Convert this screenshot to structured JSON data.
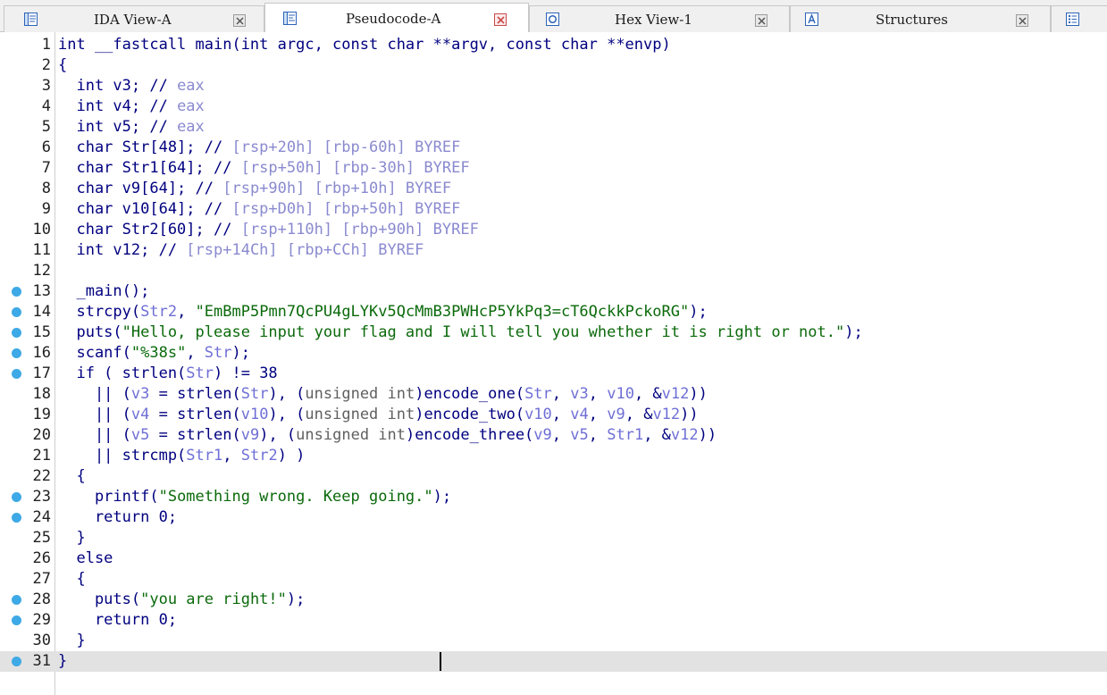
{
  "tabs": [
    {
      "label": "IDA View-A",
      "icon": "disassembly-view-icon",
      "active": false
    },
    {
      "label": "Pseudocode-A",
      "icon": "pseudocode-icon",
      "active": true
    },
    {
      "label": "Hex View-1",
      "icon": "hex-view-icon",
      "active": false
    },
    {
      "label": "Structures",
      "icon": "structures-icon",
      "active": false
    },
    {
      "icon": "enums-icon",
      "active": false
    }
  ],
  "colors": {
    "keyword": "#000080",
    "variable": "#6f6fd6",
    "comment": "#8a8ad0",
    "string": "#0b6a0b",
    "breakpoint": "#3da9e6",
    "current_line": "#e2e2e2"
  },
  "code_lines": [
    {
      "num": "1",
      "bp": false,
      "tokens": [
        [
          "n",
          "int __fastcall main(int argc, const char **argv, const char **envp)"
        ]
      ]
    },
    {
      "num": "2",
      "bp": false,
      "tokens": [
        [
          "n",
          "{"
        ]
      ]
    },
    {
      "num": "3",
      "bp": false,
      "tokens": [
        [
          "n",
          "  int v3; // "
        ],
        [
          "c",
          "eax"
        ]
      ]
    },
    {
      "num": "4",
      "bp": false,
      "tokens": [
        [
          "n",
          "  int v4; // "
        ],
        [
          "c",
          "eax"
        ]
      ]
    },
    {
      "num": "5",
      "bp": false,
      "tokens": [
        [
          "n",
          "  int v5; // "
        ],
        [
          "c",
          "eax"
        ]
      ]
    },
    {
      "num": "6",
      "bp": false,
      "tokens": [
        [
          "n",
          "  char Str[48]; // "
        ],
        [
          "c",
          "[rsp+20h] [rbp-60h] BYREF"
        ]
      ]
    },
    {
      "num": "7",
      "bp": false,
      "tokens": [
        [
          "n",
          "  char Str1[64]; // "
        ],
        [
          "c",
          "[rsp+50h] [rbp-30h] BYREF"
        ]
      ]
    },
    {
      "num": "8",
      "bp": false,
      "tokens": [
        [
          "n",
          "  char v9[64]; // "
        ],
        [
          "c",
          "[rsp+90h] [rbp+10h] BYREF"
        ]
      ]
    },
    {
      "num": "9",
      "bp": false,
      "tokens": [
        [
          "n",
          "  char v10[64]; // "
        ],
        [
          "c",
          "[rsp+D0h] [rbp+50h] BYREF"
        ]
      ]
    },
    {
      "num": "10",
      "bp": false,
      "tokens": [
        [
          "n",
          "  char Str2[60]; // "
        ],
        [
          "c",
          "[rsp+110h] [rbp+90h] BYREF"
        ]
      ]
    },
    {
      "num": "11",
      "bp": false,
      "tokens": [
        [
          "n",
          "  int v12; // "
        ],
        [
          "c",
          "[rsp+14Ch] [rbp+CCh] BYREF"
        ]
      ]
    },
    {
      "num": "12",
      "bp": false,
      "tokens": []
    },
    {
      "num": "13",
      "bp": true,
      "tokens": [
        [
          "n",
          "  _main();"
        ]
      ]
    },
    {
      "num": "14",
      "bp": true,
      "tokens": [
        [
          "n",
          "  strcpy("
        ],
        [
          "v",
          "Str2"
        ],
        [
          "n",
          ", "
        ],
        [
          "s",
          "\"EmBmP5Pmn7QcPU4gLYKv5QcMmB3PWHcP5YkPq3=cT6QckkPckoRG\""
        ],
        [
          "n",
          ");"
        ]
      ]
    },
    {
      "num": "15",
      "bp": true,
      "tokens": [
        [
          "n",
          "  puts("
        ],
        [
          "s",
          "\"Hello, please input your flag and I will tell you whether it is right or not.\""
        ],
        [
          "n",
          ");"
        ]
      ]
    },
    {
      "num": "16",
      "bp": true,
      "tokens": [
        [
          "n",
          "  scanf("
        ],
        [
          "s",
          "\"%38s\""
        ],
        [
          "n",
          ", "
        ],
        [
          "v",
          "Str"
        ],
        [
          "n",
          ");"
        ]
      ]
    },
    {
      "num": "17",
      "bp": true,
      "tokens": [
        [
          "n",
          "  if ( strlen("
        ],
        [
          "v",
          "Str"
        ],
        [
          "n",
          ") != 38"
        ]
      ]
    },
    {
      "num": "18",
      "bp": false,
      "tokens": [
        [
          "n",
          "    || ("
        ],
        [
          "v",
          "v3"
        ],
        [
          "n",
          " = strlen("
        ],
        [
          "v",
          "Str"
        ],
        [
          "n",
          "), ("
        ],
        [
          "u",
          "unsigned int"
        ],
        [
          "n",
          ")encode_one("
        ],
        [
          "v",
          "Str"
        ],
        [
          "n",
          ", "
        ],
        [
          "v",
          "v3"
        ],
        [
          "n",
          ", "
        ],
        [
          "v",
          "v10"
        ],
        [
          "n",
          ", &"
        ],
        [
          "v",
          "v12"
        ],
        [
          "n",
          "))"
        ]
      ]
    },
    {
      "num": "19",
      "bp": false,
      "tokens": [
        [
          "n",
          "    || ("
        ],
        [
          "v",
          "v4"
        ],
        [
          "n",
          " = strlen("
        ],
        [
          "v",
          "v10"
        ],
        [
          "n",
          "), ("
        ],
        [
          "u",
          "unsigned int"
        ],
        [
          "n",
          ")encode_two("
        ],
        [
          "v",
          "v10"
        ],
        [
          "n",
          ", "
        ],
        [
          "v",
          "v4"
        ],
        [
          "n",
          ", "
        ],
        [
          "v",
          "v9"
        ],
        [
          "n",
          ", &"
        ],
        [
          "v",
          "v12"
        ],
        [
          "n",
          "))"
        ]
      ]
    },
    {
      "num": "20",
      "bp": false,
      "tokens": [
        [
          "n",
          "    || ("
        ],
        [
          "v",
          "v5"
        ],
        [
          "n",
          " = strlen("
        ],
        [
          "v",
          "v9"
        ],
        [
          "n",
          "), ("
        ],
        [
          "u",
          "unsigned int"
        ],
        [
          "n",
          ")encode_three("
        ],
        [
          "v",
          "v9"
        ],
        [
          "n",
          ", "
        ],
        [
          "v",
          "v5"
        ],
        [
          "n",
          ", "
        ],
        [
          "v",
          "Str1"
        ],
        [
          "n",
          ", &"
        ],
        [
          "v",
          "v12"
        ],
        [
          "n",
          "))"
        ]
      ]
    },
    {
      "num": "21",
      "bp": false,
      "tokens": [
        [
          "n",
          "    || strcmp("
        ],
        [
          "v",
          "Str1"
        ],
        [
          "n",
          ", "
        ],
        [
          "v",
          "Str2"
        ],
        [
          "n",
          ") )"
        ]
      ]
    },
    {
      "num": "22",
      "bp": false,
      "tokens": [
        [
          "n",
          "  {"
        ]
      ]
    },
    {
      "num": "23",
      "bp": true,
      "tokens": [
        [
          "n",
          "    printf("
        ],
        [
          "s",
          "\"Something wrong. Keep going.\""
        ],
        [
          "n",
          ");"
        ]
      ]
    },
    {
      "num": "24",
      "bp": true,
      "tokens": [
        [
          "n",
          "    return 0;"
        ]
      ]
    },
    {
      "num": "25",
      "bp": false,
      "tokens": [
        [
          "n",
          "  }"
        ]
      ]
    },
    {
      "num": "26",
      "bp": false,
      "tokens": [
        [
          "n",
          "  else"
        ]
      ]
    },
    {
      "num": "27",
      "bp": false,
      "tokens": [
        [
          "n",
          "  {"
        ]
      ]
    },
    {
      "num": "28",
      "bp": true,
      "tokens": [
        [
          "n",
          "    puts("
        ],
        [
          "s",
          "\"you are right!\""
        ],
        [
          "n",
          ");"
        ]
      ]
    },
    {
      "num": "29",
      "bp": true,
      "tokens": [
        [
          "n",
          "    return 0;"
        ]
      ]
    },
    {
      "num": "30",
      "bp": false,
      "tokens": [
        [
          "n",
          "  }"
        ]
      ]
    },
    {
      "num": "31",
      "bp": true,
      "current": true,
      "tokens": [
        [
          "n",
          "}"
        ]
      ]
    }
  ]
}
